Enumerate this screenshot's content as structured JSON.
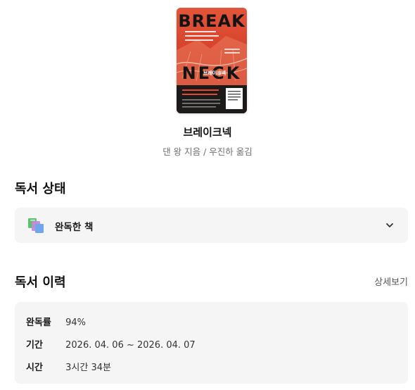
{
  "book": {
    "cover": {
      "title_top": "BREAK",
      "title_bottom": "NECK",
      "title_kr": "브레이크넥",
      "accent_color": "#d8422c"
    },
    "title": "브레이크넥",
    "author_line": "댄 왕 지음 / 우진하 옮김"
  },
  "reading_status": {
    "heading": "독서 상태",
    "selected": "완독한 책",
    "icon": "books-stack-icon",
    "dropdown_icon": "chevron-down-icon"
  },
  "reading_history": {
    "heading": "독서 이력",
    "detail_link": "상세보기",
    "rows": [
      {
        "label": "완독률",
        "value": "94%"
      },
      {
        "label": "기간",
        "value": "2026. 04. 06 ~ 2026. 04. 07"
      },
      {
        "label": "시간",
        "value": "3시간 34분"
      }
    ]
  }
}
